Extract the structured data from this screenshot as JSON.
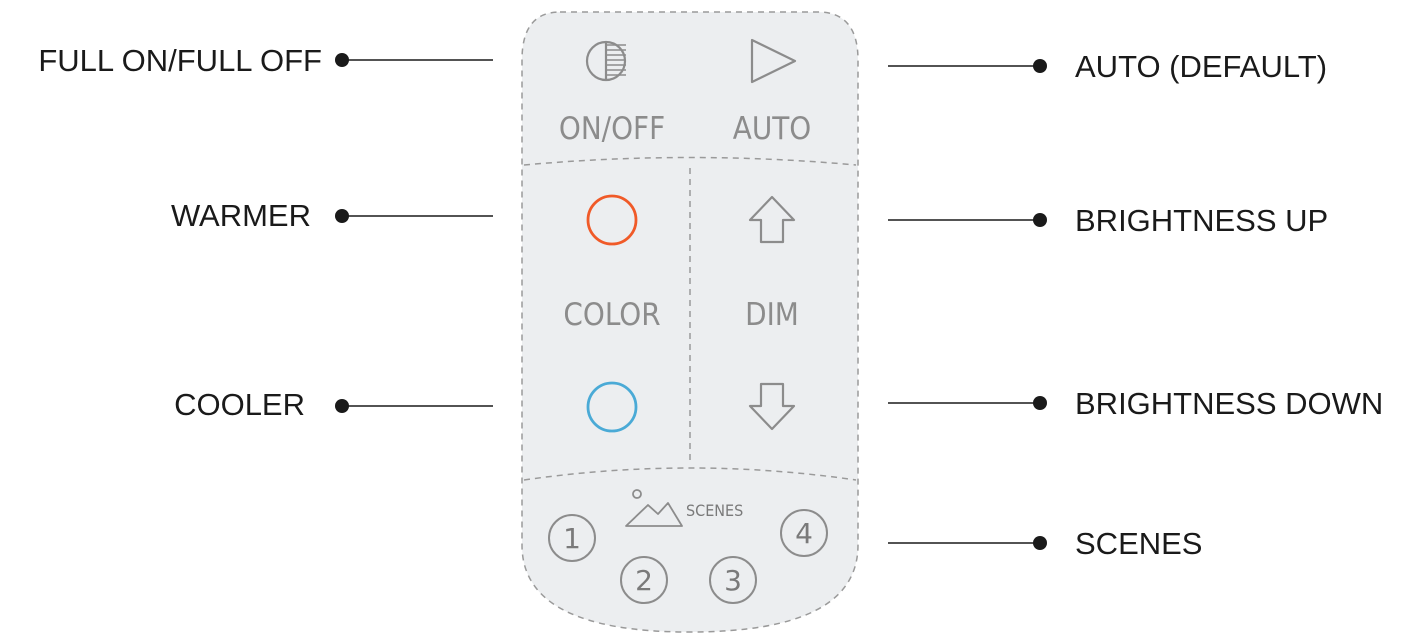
{
  "callouts": {
    "full_on_off": "FULL ON/FULL OFF",
    "auto_default": "AUTO (DEFAULT)",
    "warmer": "WARMER",
    "brightness_up": "BRIGHTNESS UP",
    "cooler": "COOLER",
    "brightness_down": "BRIGHTNESS DOWN",
    "scenes": "SCENES"
  },
  "remote": {
    "on_off_label": "ON/OFF",
    "auto_label": "AUTO",
    "color_label": "COLOR",
    "dim_label": "DIM",
    "scenes_label": "SCENES",
    "scene_buttons": [
      "1",
      "2",
      "3",
      "4"
    ]
  },
  "colors": {
    "remote_body": "#eceef0",
    "warmer_ring": "#f05a28",
    "cooler_ring": "#4aaad6",
    "icon_gray": "#8c8c8c",
    "leader_line": "#1a1a1a"
  },
  "icons": {
    "on_off": "half-filled-circle-icon",
    "auto": "play-triangle-icon",
    "warmer": "warm-circle-icon",
    "cooler": "cool-circle-icon",
    "brightness_up": "arrow-up-icon",
    "brightness_down": "arrow-down-icon",
    "scenes": "mountain-landscape-icon"
  }
}
